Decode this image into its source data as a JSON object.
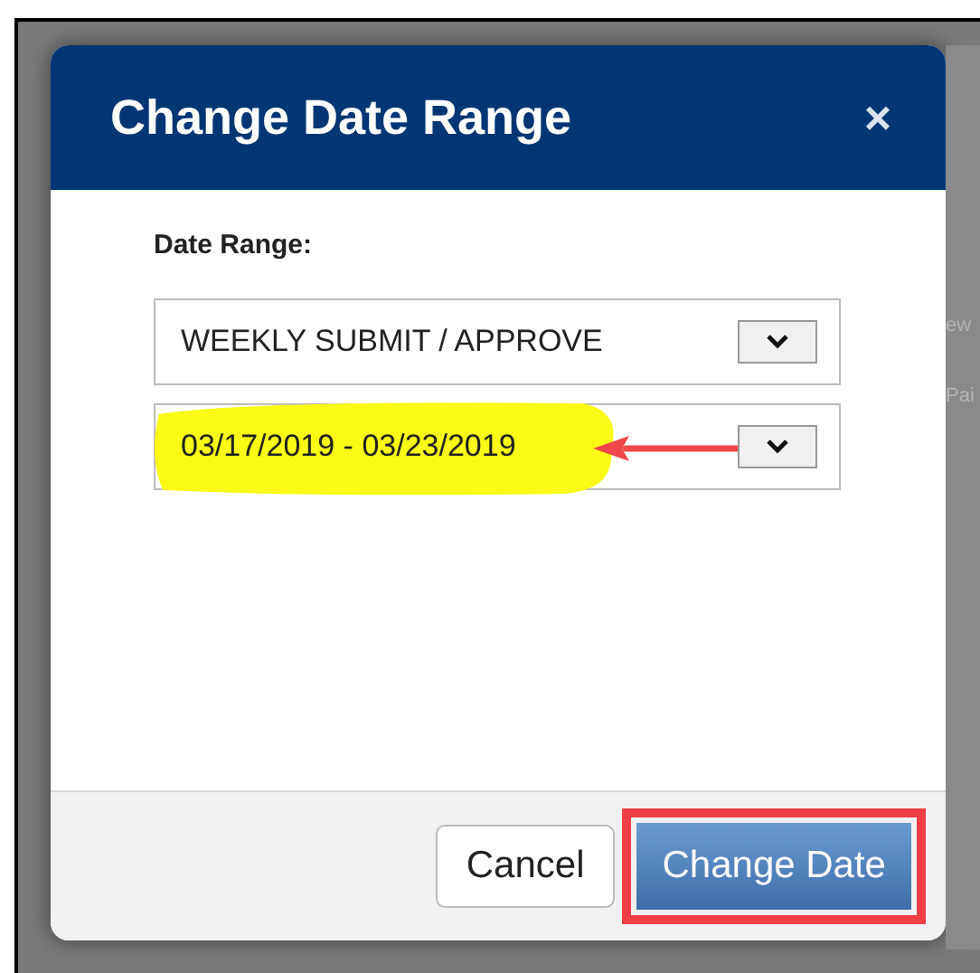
{
  "background": {
    "fragments": [
      "ew",
      "Pai"
    ]
  },
  "dialog": {
    "title": "Change Date Range",
    "close": "×",
    "label": "Date Range:",
    "selects": [
      {
        "value": "WEEKLY SUBMIT / APPROVE",
        "highlighted": false
      },
      {
        "value": "03/17/2019 - 03/23/2019",
        "highlighted": true
      }
    ],
    "buttons": [
      {
        "label": "Cancel",
        "kind": "default",
        "highlighted": false
      },
      {
        "label": "Change Date",
        "kind": "primary",
        "highlighted": true
      }
    ]
  }
}
